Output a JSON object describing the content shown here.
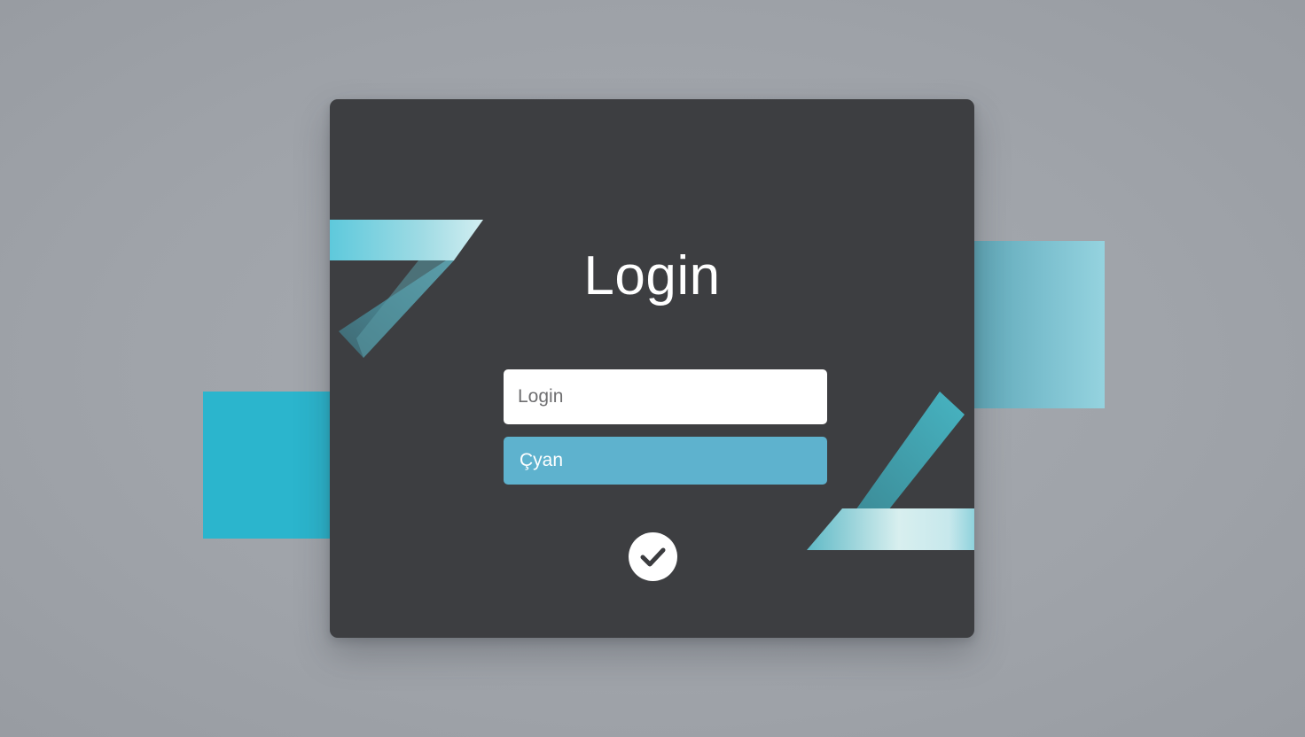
{
  "login_form": {
    "title": "Login",
    "login_field": {
      "placeholder": "Login",
      "value": ""
    },
    "second_field": {
      "value": "Çyan"
    },
    "confirm_icon": "check-icon"
  },
  "colors": {
    "background": "#a3a7ad",
    "card": "#3d3e41",
    "cyan_accent": "#2bb5cd",
    "field_cyan": "#5eb2ce",
    "text_white": "#ffffff"
  }
}
